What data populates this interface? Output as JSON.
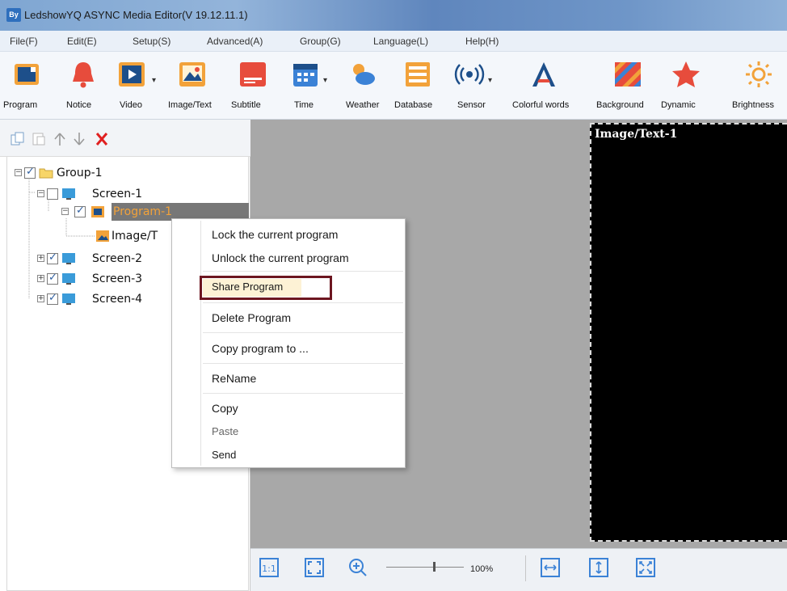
{
  "window": {
    "title": "LedshowYQ ASYNC Media Editor(V 19.12.11.1)",
    "app_icon_text": "By"
  },
  "menu": [
    "File(F)",
    "Edit(E)",
    "Setup(S)",
    "Advanced(A)",
    "Group(G)",
    "Language(L)",
    "Help(H)"
  ],
  "toolbar": {
    "program": "Program",
    "notice": "Notice",
    "video": "Video",
    "image_text": "Image/Text",
    "subtitle": "Subtitle",
    "time": "Time",
    "weather": "Weather",
    "database": "Database",
    "sensor": "Sensor",
    "colorful_words": "Colorful words",
    "background": "Background",
    "dynamic": "Dynamic",
    "brightness": "Brightness"
  },
  "tree": {
    "group": "Group-1",
    "screen1": "Screen-1",
    "program1": "Program-1",
    "image_text": "Image/T",
    "screen2": "Screen-2",
    "screen3": "Screen-3",
    "screen4": "Screen-4"
  },
  "context_menu": {
    "lock": "Lock the current program",
    "unlock": "Unlock the current program",
    "share": "Share Program",
    "delete": "Delete Program",
    "copy_to": "Copy program to ...",
    "rename": "ReName",
    "copy": "Copy",
    "paste": "Paste",
    "send": "Send"
  },
  "canvas": {
    "led_title": "Image/Text-1"
  },
  "bottom": {
    "zoom": "100%"
  }
}
